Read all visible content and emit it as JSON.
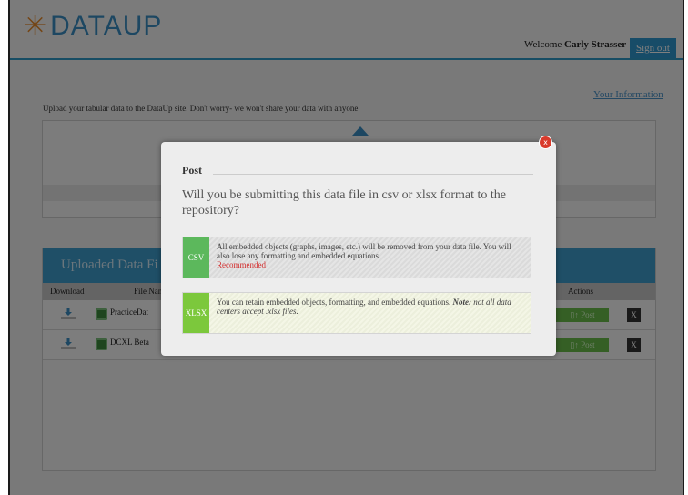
{
  "header": {
    "logo_text": "DATAUP",
    "welcome_label": "Welcome",
    "user_name": "Carly Strasser",
    "sign_out": "Sign out"
  },
  "page": {
    "your_information": "Your Information",
    "intro": "Upload your tabular data to the DataUp site. Don't worry- we won't share your data with anyone"
  },
  "files_panel": {
    "title": "Uploaded Data Fi",
    "columns": {
      "download": "Download",
      "file_name": "File Nan",
      "actions": "Actions"
    },
    "rows": [
      {
        "name": "PracticeDat",
        "post": "Post",
        "delete": "X"
      },
      {
        "name": "DCXL Beta",
        "post": "Post",
        "delete": "X"
      }
    ]
  },
  "modal": {
    "title": "Post",
    "question": "Will you be submitting this data file in csv or xlsx format to the repository?",
    "close": "x",
    "csv": {
      "tag": "CSV",
      "text": "All embedded objects (graphs, images, etc.) will be removed from your data file. You will also lose any formatting and embedded equations.",
      "recommended": "Recommended"
    },
    "xlsx": {
      "tag": "XLSX",
      "text": "You can retain embedded objects, formatting, and embedded equations.",
      "note_label": "Note:",
      "note_text": "not all data centers accept .xlsx files."
    }
  },
  "colors": {
    "brand_blue": "#2e98d0",
    "logo_orange": "#e98b2a",
    "csv_green": "#5cb85c",
    "xlsx_green": "#7cc83c",
    "recommended_red": "#d32f2f",
    "close_red": "#d93a2b"
  },
  "icons": [
    "logo-burst-icon",
    "upload-arrow-icon",
    "download-icon",
    "excel-file-icon",
    "post-icon",
    "close-icon"
  ]
}
